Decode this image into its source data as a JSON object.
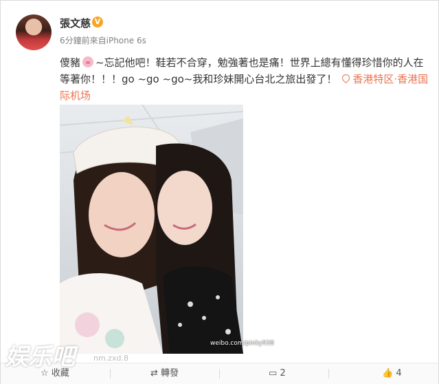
{
  "user": {
    "name": "張文慈",
    "meta": "6分鐘前來自iPhone 6s"
  },
  "post": {
    "text_part1": "傻豬",
    "text_part2": "~忘記他吧！鞋若不合穿，勉強著也是痛！世界上總有懂得珍惜你的人在等著你！！！go ~go ~go~我和珍妹開心台北之旅出發了！",
    "location": "香港特区·香港国际机场"
  },
  "photo": {
    "credit": "weibo.com/pinky938"
  },
  "actions": {
    "favorite_label": "收藏",
    "repost_label": "轉發",
    "comment_count": "2",
    "like_count": "4"
  },
  "watermark": {
    "brand": "娱乐吧",
    "sub": "nm.zxd.8"
  },
  "colors": {
    "accent": "#eb7350",
    "verified": "#f5a623"
  }
}
